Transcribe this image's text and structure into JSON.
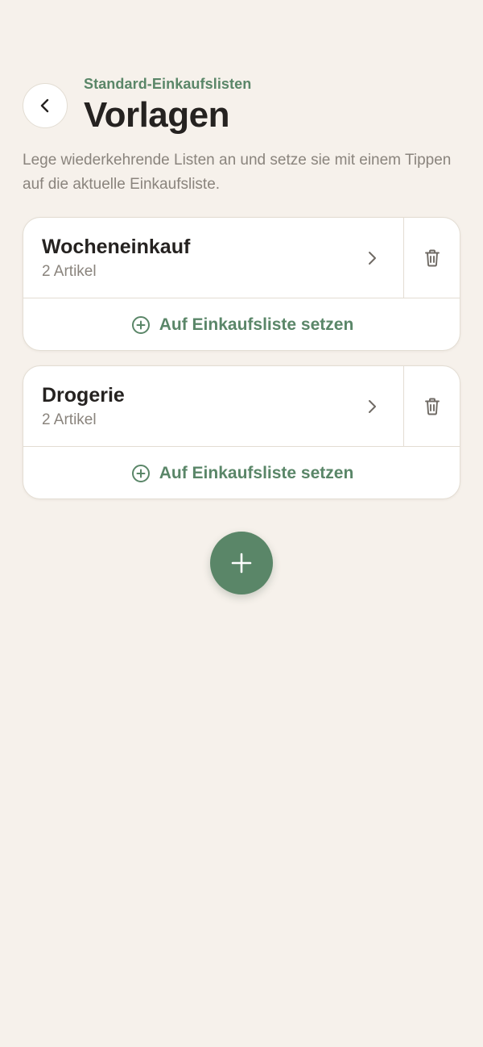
{
  "header": {
    "subtitle": "Standard-Einkaufslisten",
    "title": "Vorlagen",
    "back_icon": "chevron-left-icon"
  },
  "description": "Lege wiederkehrende Listen an und setze sie mit einem Tippen auf die aktuelle Einkaufsliste.",
  "templates": [
    {
      "name": "Wocheneinkauf",
      "count": "2 Artikel",
      "action_label": "Auf Einkaufsliste setzen"
    },
    {
      "name": "Drogerie",
      "count": "2 Artikel",
      "action_label": "Auf Einkaufsliste setzen"
    }
  ],
  "icons": {
    "open": "chevron-right-icon",
    "delete": "trash-icon",
    "apply": "plus-circle-icon",
    "add": "plus-icon"
  },
  "colors": {
    "background": "#f6f1eb",
    "accent": "#5a8668",
    "text": "#252220",
    "muted": "#8a847d",
    "border": "#e3ddd3"
  }
}
